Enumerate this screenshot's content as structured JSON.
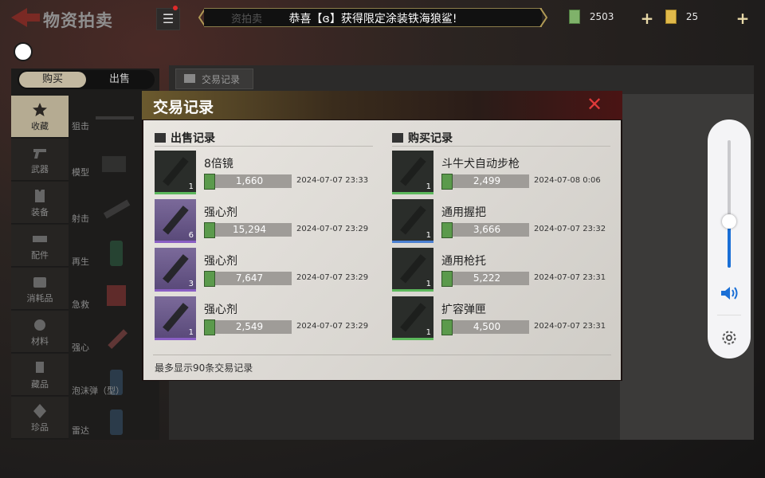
{
  "header": {
    "title": "物资拍卖",
    "marquee_ghost": "资拍卖",
    "marquee_text": "恭喜【ɞ】获得限定涂装铁海狼鲨!",
    "currency_cash": "2503",
    "currency_gold": "25"
  },
  "left": {
    "tabs": [
      "购买",
      "出售"
    ],
    "categories": [
      "收藏",
      "武器",
      "装备",
      "配件",
      "消耗品",
      "材料",
      "藏品",
      "珍品"
    ],
    "items": [
      "狙击",
      "模型",
      "射击",
      "再生",
      "急救",
      "强心",
      "泡沫弹（型）",
      "雷达"
    ]
  },
  "center": {
    "tab_label": "交易记录"
  },
  "modal": {
    "title": "交易记录",
    "close_icon": "close-icon",
    "sell_header": "出售记录",
    "buy_header": "购买记录",
    "footer": "最多显示90条交易记录",
    "sell_records": [
      {
        "name": "8倍镜",
        "qty": "1",
        "price": "1,660",
        "time": "2024-07-07 23:33",
        "rarity": "green"
      },
      {
        "name": "强心剂",
        "qty": "6",
        "price": "15,294",
        "time": "2024-07-07 23:29",
        "rarity": "purple"
      },
      {
        "name": "强心剂",
        "qty": "3",
        "price": "7,647",
        "time": "2024-07-07 23:29",
        "rarity": "purple"
      },
      {
        "name": "强心剂",
        "qty": "1",
        "price": "2,549",
        "time": "2024-07-07 23:29",
        "rarity": "purple"
      }
    ],
    "buy_records": [
      {
        "name": "斗牛犬自动步枪",
        "qty": "1",
        "price": "2,499",
        "time": "2024-07-08 0:06",
        "rarity": "green"
      },
      {
        "name": "通用握把",
        "qty": "1",
        "price": "3,666",
        "time": "2024-07-07 23:32",
        "rarity": "blue"
      },
      {
        "name": "通用枪托",
        "qty": "1",
        "price": "5,222",
        "time": "2024-07-07 23:31",
        "rarity": "green"
      },
      {
        "name": "扩容弹匣",
        "qty": "1",
        "price": "4,500",
        "time": "2024-07-07 23:31",
        "rarity": "green"
      }
    ]
  },
  "volume": {
    "level": 0.36,
    "accent": "#1a6fd6"
  }
}
